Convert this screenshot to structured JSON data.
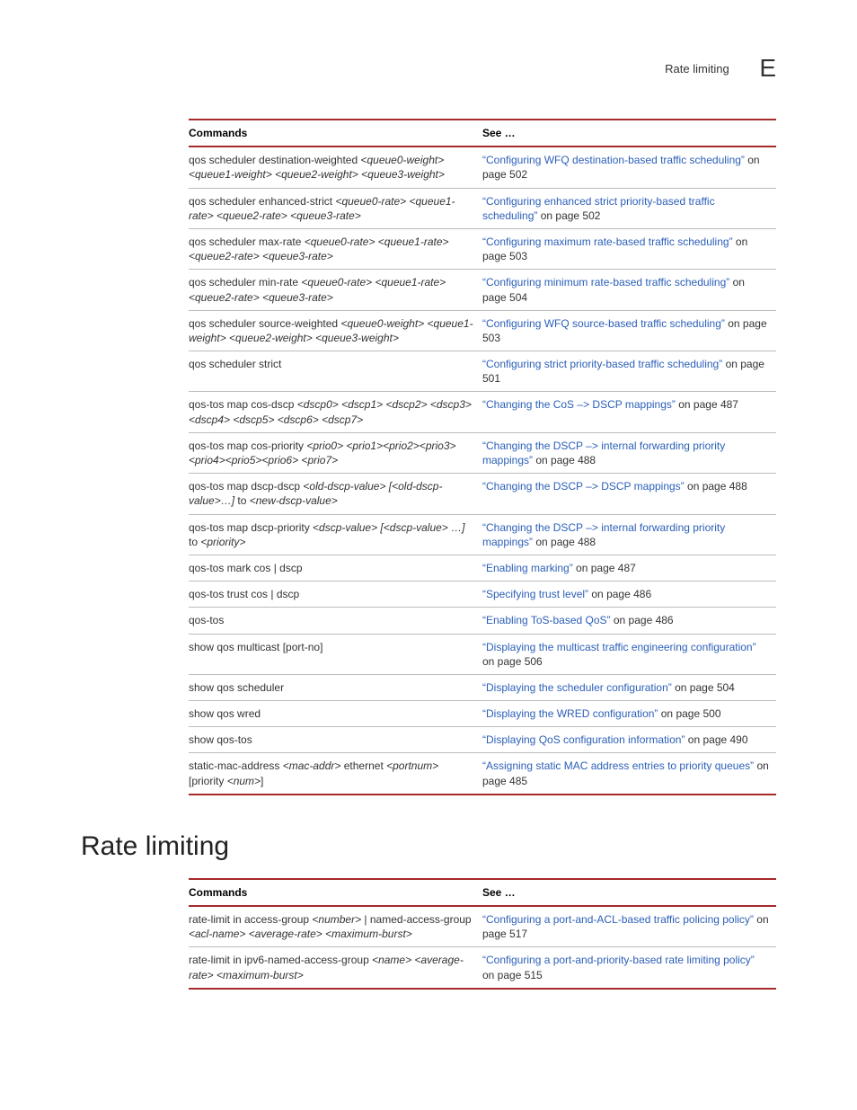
{
  "header": {
    "section_label": "Rate limiting",
    "appendix_letter": "E"
  },
  "table1": {
    "head": {
      "c1": "Commands",
      "c2": "See …"
    },
    "rows": [
      {
        "cmd_pre": "qos scheduler destination-weighted ",
        "cmd_args": "<queue0-weight> <queue1-weight> <queue2-weight> <queue3-weight>",
        "link": "“Configuring WFQ destination-based traffic scheduling”",
        "suffix": " on page 502"
      },
      {
        "cmd_pre": "qos scheduler enhanced-strict ",
        "cmd_args": "<queue0-rate> <queue1-rate> <queue2-rate> <queue3-rate>",
        "link": "“Configuring enhanced strict priority-based traffic scheduling”",
        "suffix": " on page 502"
      },
      {
        "cmd_pre": "qos scheduler max-rate ",
        "cmd_args": "<queue0-rate> <queue1-rate> <queue2-rate> <queue3-rate>",
        "link": "“Configuring maximum rate-based traffic scheduling”",
        "suffix": " on page 503"
      },
      {
        "cmd_pre": "qos scheduler min-rate ",
        "cmd_args": "<queue0-rate> <queue1-rate> <queue2-rate> <queue3-rate>",
        "link": "“Configuring minimum rate-based traffic scheduling”",
        "suffix": " on page 504"
      },
      {
        "cmd_pre": "qos scheduler source-weighted ",
        "cmd_args": "<queue0-weight> <queue1-weight> <queue2-weight> <queue3-weight>",
        "link": "“Configuring WFQ source-based traffic scheduling”",
        "suffix": " on page 503"
      },
      {
        "cmd_pre": "qos scheduler strict",
        "cmd_args": "",
        "link": "“Configuring strict priority-based traffic scheduling”",
        "suffix": " on page 501"
      },
      {
        "cmd_pre": "qos-tos map cos-dscp ",
        "cmd_args": "<dscp0> <dscp1> <dscp2> <dscp3> <dscp4> <dscp5> <dscp6> <dscp7>",
        "link": "“Changing the CoS –> DSCP mappings”",
        "suffix": " on page 487"
      },
      {
        "cmd_pre": "qos-tos map cos-priority ",
        "cmd_args": "<prio0> <prio1><prio2><prio3><prio4><prio5><prio6> <prio7>",
        "link": "“Changing the DSCP –> internal forwarding priority mappings”",
        "suffix": " on page 488"
      },
      {
        "cmd_pre": "qos-tos map dscp-dscp ",
        "cmd_args": "<old-dscp-value> [<old-dscp-value>…]",
        "cmd_pre2": " to ",
        "cmd_args2": "<new-dscp-value>",
        "link": "“Changing the DSCP –> DSCP mappings”",
        "suffix": " on page 488"
      },
      {
        "cmd_pre": "qos-tos map dscp-priority ",
        "cmd_args": "<dscp-value> [<dscp-value> …]",
        "cmd_pre2": " to ",
        "cmd_args2": "<priority>",
        "link": "“Changing the DSCP –> internal forwarding priority mappings”",
        "suffix": " on page 488"
      },
      {
        "cmd_pre": "qos-tos mark cos | dscp",
        "cmd_args": "",
        "link": "“Enabling marking”",
        "suffix": " on page 487"
      },
      {
        "cmd_pre": "qos-tos trust cos | dscp",
        "cmd_args": "",
        "link": "“Specifying trust level”",
        "suffix": " on page 486"
      },
      {
        "cmd_pre": "qos-tos",
        "cmd_args": "",
        "link": "“Enabling ToS-based QoS”",
        "suffix": " on page 486"
      },
      {
        "cmd_pre": "show qos multicast [port-no]",
        "cmd_args": "",
        "link": "“Displaying the multicast traffic engineering configuration”",
        "suffix": " on page 506"
      },
      {
        "cmd_pre": "show qos scheduler",
        "cmd_args": "",
        "link": "“Displaying the scheduler configuration”",
        "suffix": " on page 504"
      },
      {
        "cmd_pre": "show qos wred",
        "cmd_args": "",
        "link": "“Displaying the WRED configuration”",
        "suffix": " on page 500"
      },
      {
        "cmd_pre": "show qos-tos",
        "cmd_args": "",
        "link": "“Displaying QoS configuration information”",
        "suffix": " on page 490"
      },
      {
        "cmd_pre": "static-mac-address ",
        "cmd_args": "<mac-addr>",
        "cmd_pre2": " ethernet ",
        "cmd_args2": "<portnum>",
        "cmd_pre3": " [priority ",
        "cmd_args3": "<num>",
        "cmd_post3": "]",
        "link": "“Assigning static MAC address entries to priority queues”",
        "suffix": " on page 485"
      }
    ]
  },
  "section_heading": "Rate limiting",
  "table2": {
    "head": {
      "c1": "Commands",
      "c2": "See …"
    },
    "rows": [
      {
        "cmd_pre": "rate-limit in access-group ",
        "cmd_args": "<number>",
        "cmd_pre2": " | named-access-group ",
        "cmd_args2": "<acl-name> <average-rate> <maximum-burst>",
        "link": "“Configuring a port-and-ACL-based traffic policing policy”",
        "suffix": " on page 517"
      },
      {
        "cmd_pre": "rate-limit in ipv6-named-access-group ",
        "cmd_args": "<name> <average-rate> <maximum-burst>",
        "link": "“Configuring a port-and-priority-based rate limiting policy”",
        "suffix": " on page 515"
      }
    ]
  }
}
